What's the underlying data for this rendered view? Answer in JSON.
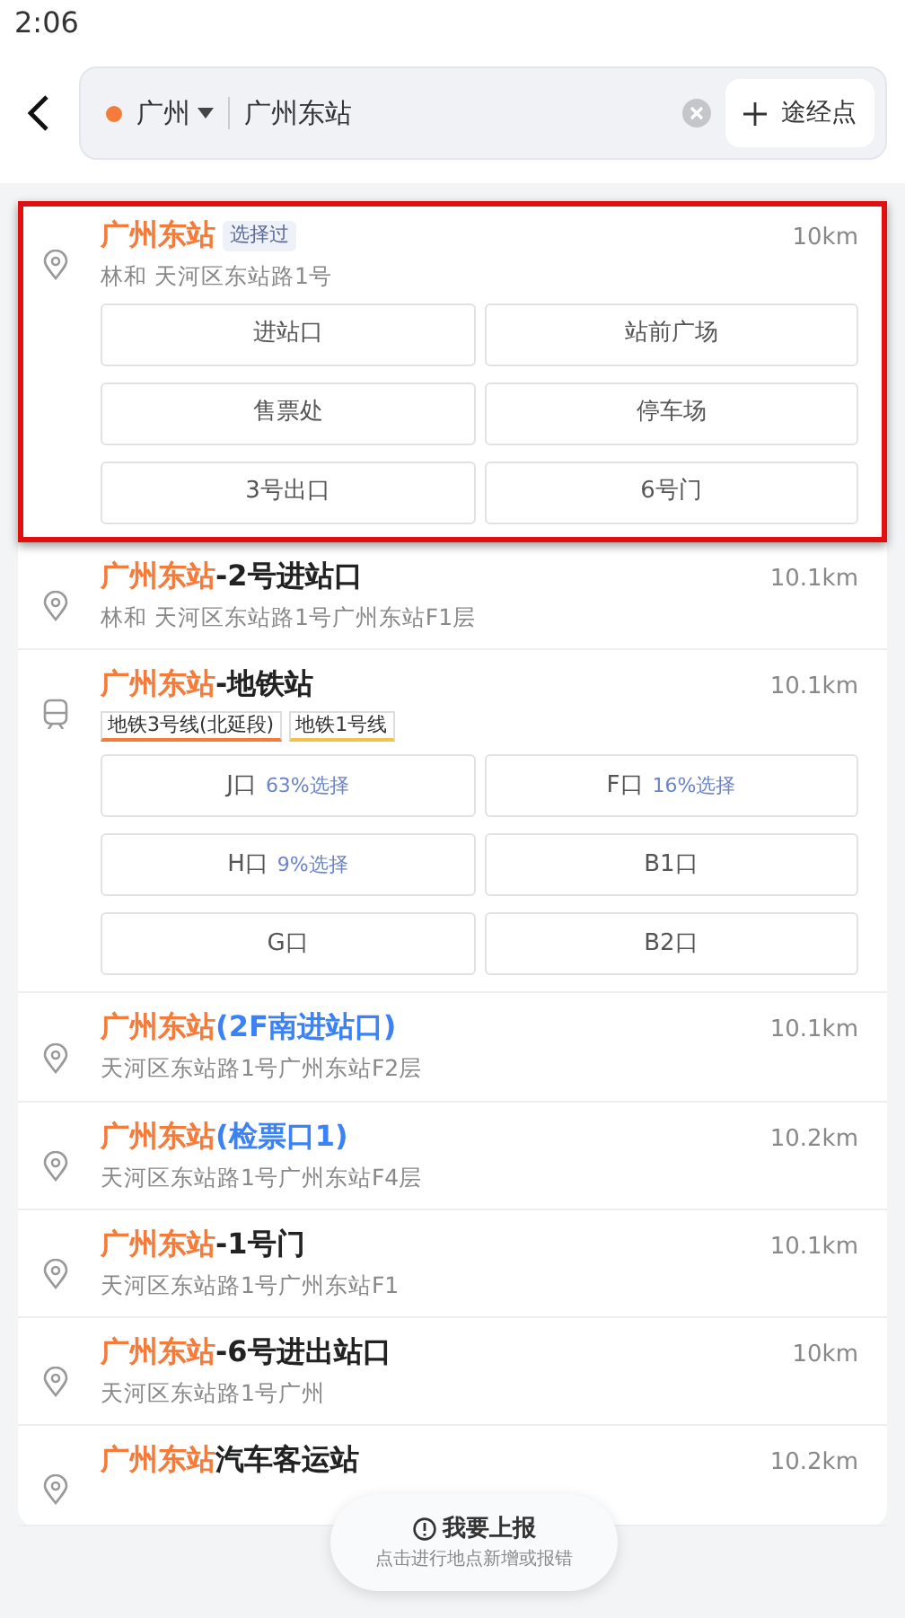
{
  "status_bar": {
    "time": "2:06"
  },
  "search": {
    "city": "广州",
    "value": "广州东站",
    "via_button": "途经点"
  },
  "results": [
    {
      "kind": "place",
      "highlighted": true,
      "title": [
        {
          "text": "广州东站",
          "kind": "match"
        }
      ],
      "badge": "选择过",
      "subtitle": "林和  天河区东站路1号",
      "distance": "10km",
      "entrances": [
        {
          "label": "进站口"
        },
        {
          "label": "站前广场"
        },
        {
          "label": "售票处"
        },
        {
          "label": "停车场"
        },
        {
          "label": "3号出口"
        },
        {
          "label": "6号门"
        }
      ]
    },
    {
      "kind": "place",
      "highlighted": false,
      "title": [
        {
          "text": "广州东站",
          "kind": "match"
        },
        {
          "text": "-2号进站口",
          "kind": "plain"
        }
      ],
      "subtitle": "林和  天河区东站路1号广州东站F1层",
      "distance": "10.1km"
    },
    {
      "kind": "metro",
      "highlighted": false,
      "title": [
        {
          "text": "广州东站",
          "kind": "match"
        },
        {
          "text": "-地铁站",
          "kind": "plain"
        }
      ],
      "distance": "10.1km",
      "lines": [
        {
          "label": "地铁3号线(北延段)",
          "color": "#f47b3a"
        },
        {
          "label": "地铁1号线",
          "color": "#f2c14e"
        }
      ],
      "entrances": [
        {
          "label": "J口",
          "share": "63%选择"
        },
        {
          "label": "F口",
          "share": "16%选择"
        },
        {
          "label": "H口",
          "share": "9%选择"
        },
        {
          "label": "B1口"
        },
        {
          "label": "G口"
        },
        {
          "label": "B2口"
        }
      ]
    },
    {
      "kind": "place",
      "highlighted": false,
      "title": [
        {
          "text": "广州东站",
          "kind": "match"
        },
        {
          "text": "(2F南进站口)",
          "kind": "alias"
        }
      ],
      "subtitle": "天河区东站路1号广州东站F2层",
      "distance": "10.1km"
    },
    {
      "kind": "place",
      "highlighted": false,
      "title": [
        {
          "text": "广州东站",
          "kind": "match"
        },
        {
          "text": "(检票口1)",
          "kind": "alias"
        }
      ],
      "subtitle": "天河区东站路1号广州东站F4层",
      "distance": "10.2km"
    },
    {
      "kind": "place",
      "highlighted": false,
      "title": [
        {
          "text": "广州东站",
          "kind": "match"
        },
        {
          "text": "-1号门",
          "kind": "plain"
        }
      ],
      "subtitle": "天河区东站路1号广州东站F1",
      "distance": "10.1km"
    },
    {
      "kind": "place",
      "highlighted": false,
      "title": [
        {
          "text": "广州东站",
          "kind": "match"
        },
        {
          "text": "-6号进出站口",
          "kind": "plain"
        }
      ],
      "subtitle": "天河区东站路1号广州",
      "distance": "10km"
    },
    {
      "kind": "place",
      "highlighted": false,
      "title": [
        {
          "text": "广州东站",
          "kind": "match"
        },
        {
          "text": "汽车客运站",
          "kind": "plain"
        }
      ],
      "distance": "10.2km"
    }
  ],
  "report": {
    "title": "我要上报",
    "hint": "点击进行地点新增或报错"
  }
}
